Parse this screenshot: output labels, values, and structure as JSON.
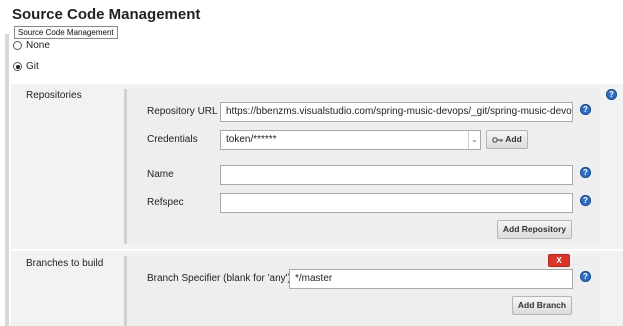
{
  "section_title": "Source Code Management",
  "tooltip": "Source Code Management",
  "scm_options": {
    "none_label": "None",
    "git_label": "Git",
    "selected": "Git"
  },
  "repositories": {
    "label": "Repositories",
    "repository_url_label": "Repository URL",
    "repository_url_value": "https://bbenzms.visualstudio.com/spring-music-devops/_git/spring-music-devops",
    "credentials_label": "Credentials",
    "credentials_value": "token/******",
    "add_button": "Add",
    "name_label": "Name",
    "name_value": "",
    "refspec_label": "Refspec",
    "refspec_value": "",
    "add_repository_button": "Add Repository"
  },
  "branches": {
    "label": "Branches to build",
    "delete_button": "X",
    "branch_specifier_label": "Branch Specifier (blank for 'any')",
    "branch_specifier_value": "*/master",
    "add_branch_button": "Add Branch"
  },
  "help_glyph": "?",
  "icons": [
    "help-icon",
    "key-icon",
    "dropdown-arrow-icon"
  ],
  "colors": {
    "help_icon": "#2e6fc0",
    "delete_button": "#d9362b",
    "section_background": "#f2f2f2",
    "box_background": "#eeeeee"
  }
}
